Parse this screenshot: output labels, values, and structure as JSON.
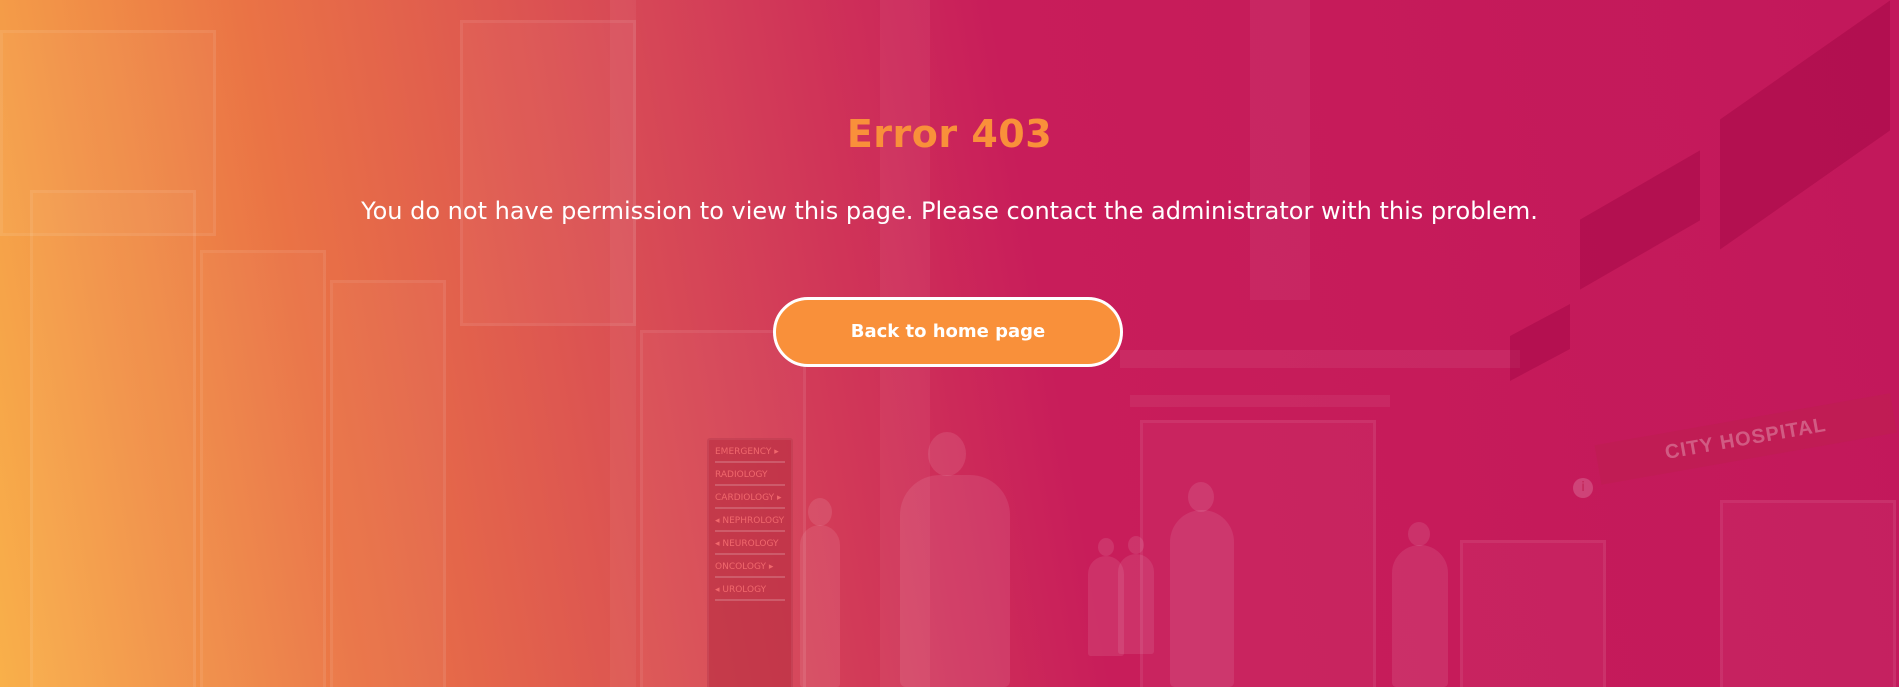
{
  "error": {
    "title": "Error 403",
    "message": "You do not have permission to view this page. Please contact the administrator with this problem.",
    "button_label": "Back to home page"
  },
  "background": {
    "sign_rows": [
      "EMERGENCY ▸",
      "RADIOLOGY",
      "CARDIOLOGY ▸",
      "◂ NEPHROLOGY",
      "◂ NEUROLOGY",
      "ONCOLOGY ▸",
      "◂ UROLOGY"
    ],
    "banner_text": "CITY HOSPITAL",
    "info_icon": "i"
  },
  "colors": {
    "accent": "#f9903a",
    "gradient_start": "#f9b04a",
    "gradient_end": "#c2185b",
    "text": "#ffffff"
  }
}
